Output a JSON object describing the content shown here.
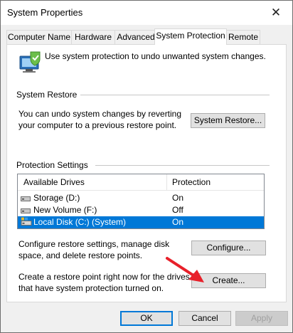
{
  "window": {
    "title": "System Properties",
    "close_glyph": "✕"
  },
  "tabs": [
    {
      "label": "Computer Name",
      "active": false
    },
    {
      "label": "Hardware",
      "active": false
    },
    {
      "label": "Advanced",
      "active": false
    },
    {
      "label": "System Protection",
      "active": true
    },
    {
      "label": "Remote",
      "active": false
    }
  ],
  "intro": {
    "text": "Use system protection to undo unwanted system changes.",
    "icon": "system-protection-icon"
  },
  "system_restore": {
    "section_label": "System Restore",
    "description": "You can undo system changes by reverting your computer to a previous restore point.",
    "button_label": "System Restore...",
    "button_mnemonic": "S"
  },
  "protection": {
    "section_label": "Protection Settings",
    "columns": [
      "Available Drives",
      "Protection"
    ],
    "drives": [
      {
        "name": "Storage (D:)",
        "protection": "On",
        "selected": false,
        "icon": "drive-icon"
      },
      {
        "name": "New Volume (F:)",
        "protection": "Off",
        "selected": false,
        "icon": "drive-icon"
      },
      {
        "name": "Local Disk (C:) (System)",
        "protection": "On",
        "selected": true,
        "icon": "system-drive-icon"
      }
    ],
    "configure_text": "Configure restore settings, manage disk space, and delete restore points.",
    "configure_label": "Configure...",
    "create_text": "Create a restore point right now for the drives that have system protection turned on.",
    "create_label": "Create..."
  },
  "footer": {
    "ok_label": "OK",
    "cancel_label": "Cancel",
    "apply_label": "Apply",
    "apply_enabled": false
  },
  "colors": {
    "selection": "#0078d7",
    "annotation_arrow": "#e8202a"
  }
}
